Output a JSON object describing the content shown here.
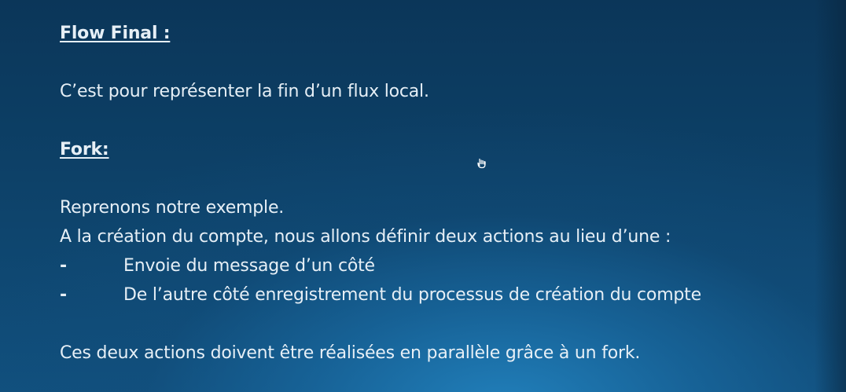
{
  "slide": {
    "heading_flow_final": "Flow Final :",
    "flow_final_text": "C’est pour représenter la fin d’un flux local.",
    "heading_fork": "Fork:",
    "fork_intro": "Reprenons notre exemple.",
    "fork_detail": "A la création du compte, nous allons définir deux actions au lieu d’une :",
    "bullets": [
      {
        "dash": "-",
        "text": "Envoie du message d’un côté"
      },
      {
        "dash": "-",
        "text": "De l’autre côté enregistrement du processus de création du compte"
      }
    ],
    "conclusion": "Ces deux actions doivent être réalisées en parallèle grâce à un fork."
  },
  "cursor": {
    "icon": "hand-pointer-icon"
  }
}
